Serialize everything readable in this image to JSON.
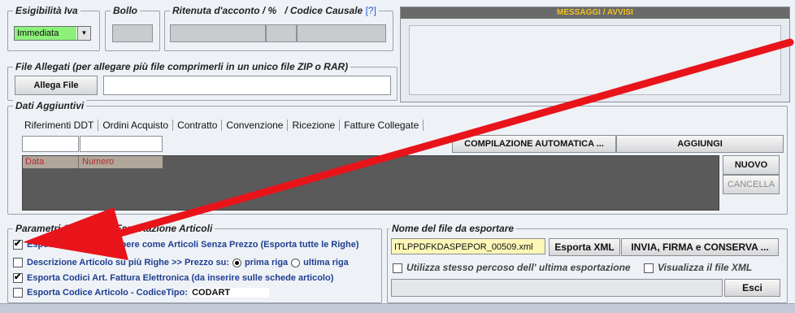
{
  "esigibilita": {
    "legend": "Esigibilità Iva",
    "value": "Immediata"
  },
  "bollo": {
    "legend": "Bollo"
  },
  "ritenuta": {
    "legend": "Ritenuta d'acconto / %   / Codice Causale",
    "help": "[?]"
  },
  "messaggi": {
    "title": "MESSAGGI / AVVISI"
  },
  "allegati": {
    "legend": "File Allegati  (per allegare più file comprimerli in un unico file ZIP o RAR)",
    "button": "Allega File"
  },
  "dati": {
    "legend": "Dati Aggiuntivi",
    "tabs": [
      "Riferimenti DDT",
      "Ordini Acquisto",
      "Contratto",
      "Convenzione",
      "Ricezione",
      "Fatture Collegate"
    ],
    "compila_button": "COMPILAZIONE AUTOMATICA ...",
    "aggiungi_button": "AGGIUNGI",
    "nuovo_button": "NUOVO",
    "cancella_button": "CANCELLA",
    "columns": [
      "Data",
      "Numero"
    ]
  },
  "parametri": {
    "legend_a": "Parametri C",
    "legend_b": "per Esportazione Articoli",
    "opt1": "Esporta Descrizioni Libere come Articoli Senza Prezzo (Esporta tutte le Righe)",
    "opt2": "Descrizione Articolo su più Righe >> Prezzo su:",
    "radio1": "prima riga",
    "radio2": "ultima riga",
    "opt3": "Esporta Codici Art. Fattura Elettronica (da inserire sulle schede articolo)",
    "opt4": "Esporta Codice Articolo - CodiceTipo:",
    "codice_tipo": "CODART"
  },
  "nomefile": {
    "legend": "Nome del file da esportare",
    "filename": "ITLPPDFKDASPEPOR_00509.xml",
    "esporta_button": "Esporta XML",
    "invia_button": "INVIA, FIRMA e CONSERVA ...",
    "stesso_percorso": "Utilizza stesso percoso dell' ultima esportazione",
    "visualizza": "Visualizza il file XML",
    "esci_button": "Esci"
  },
  "colors": {
    "arrow": "#e8141a",
    "accent_text": "#1f3f8f",
    "message_header": "#6a6a6a",
    "grid_bg": "#5a5a5a",
    "grid_header": "#b0a79a",
    "grid_header_text": "#b3272d"
  }
}
